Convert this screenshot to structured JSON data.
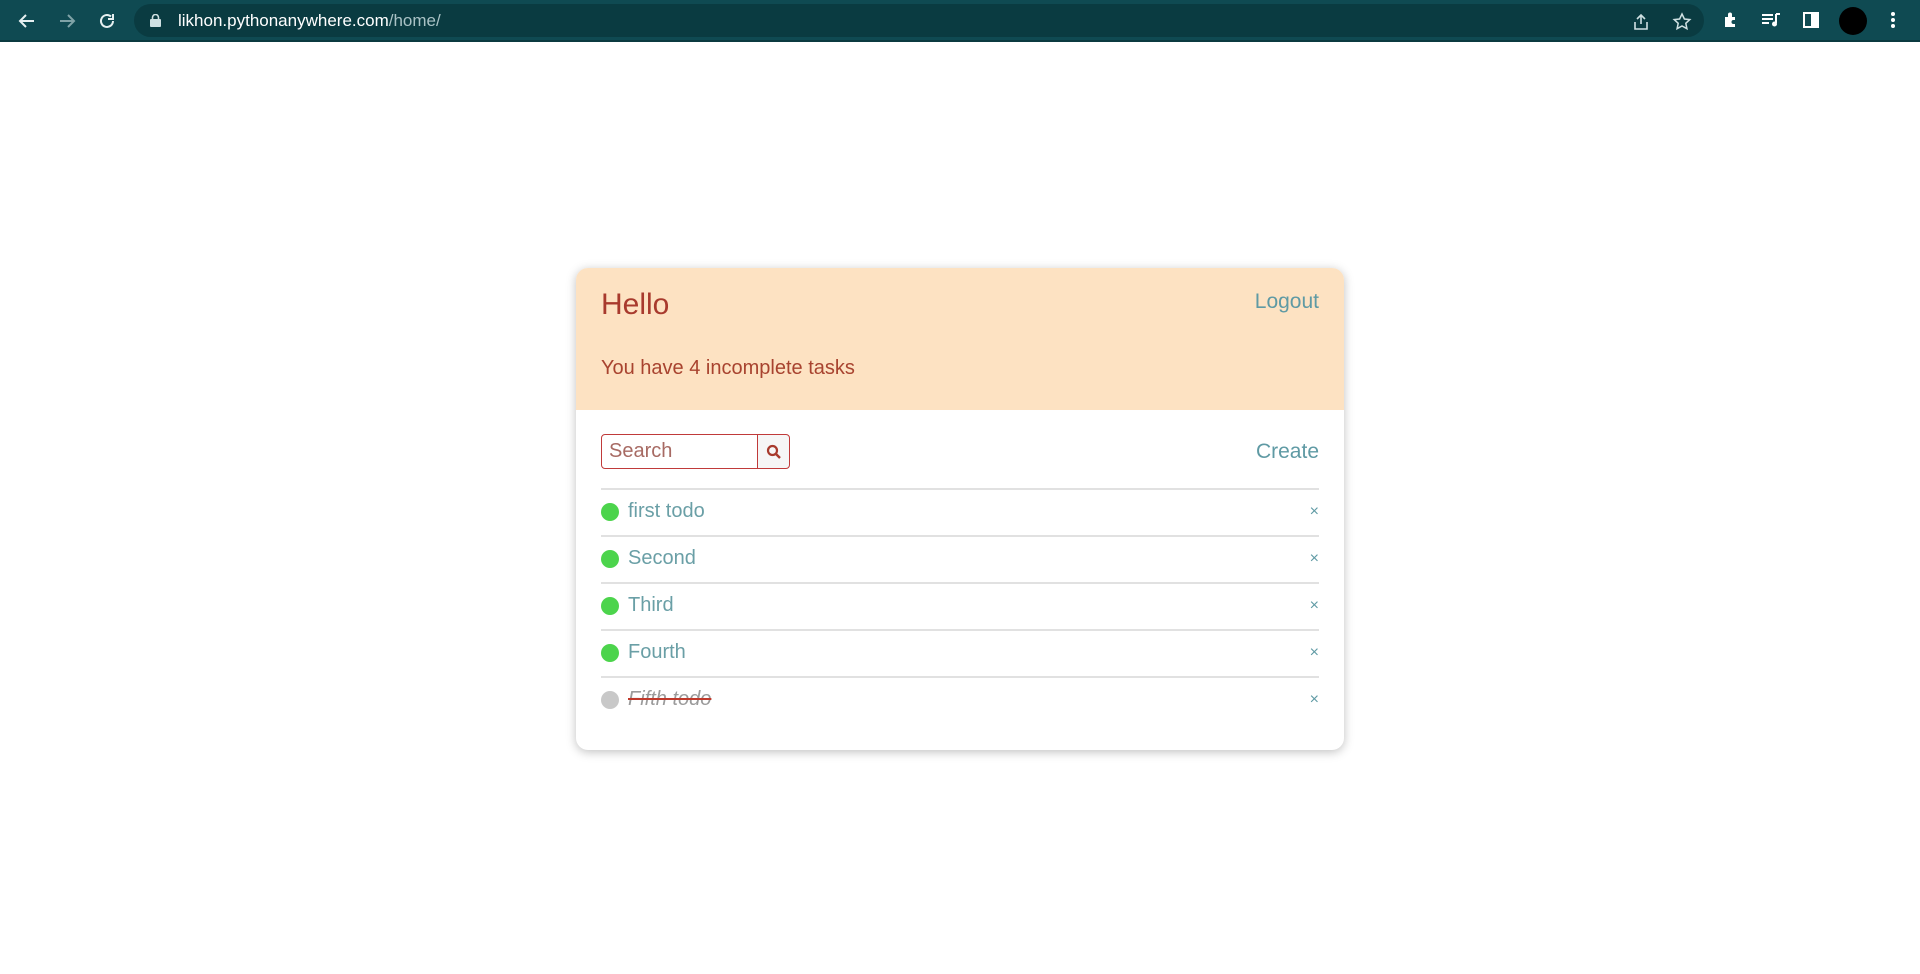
{
  "browser": {
    "url_host": "likhon.pythonanywhere.com",
    "url_path": "/home/"
  },
  "header": {
    "greeting": "Hello",
    "logout_label": "Logout",
    "task_count_text": "You have 4 incomplete tasks"
  },
  "toolbar": {
    "search_placeholder": "Search",
    "create_label": "Create"
  },
  "tasks": [
    {
      "title": "first todo",
      "status": "incomplete",
      "status_color": "#4cd44c",
      "delete_label": "×"
    },
    {
      "title": "Second",
      "status": "incomplete",
      "status_color": "#4cd44c",
      "delete_label": "×"
    },
    {
      "title": "Third",
      "status": "incomplete",
      "status_color": "#4cd44c",
      "delete_label": "×"
    },
    {
      "title": "Fourth",
      "status": "incomplete",
      "status_color": "#4cd44c",
      "delete_label": "×"
    },
    {
      "title": "Fifth todo",
      "status": "complete",
      "status_color": "#c8c8c8",
      "delete_label": "×"
    }
  ],
  "colors": {
    "chrome_bg": "#0f4a52",
    "header_bg": "#fde2c2",
    "accent_red": "#a83a2d",
    "accent_teal": "#5f9aa4"
  }
}
